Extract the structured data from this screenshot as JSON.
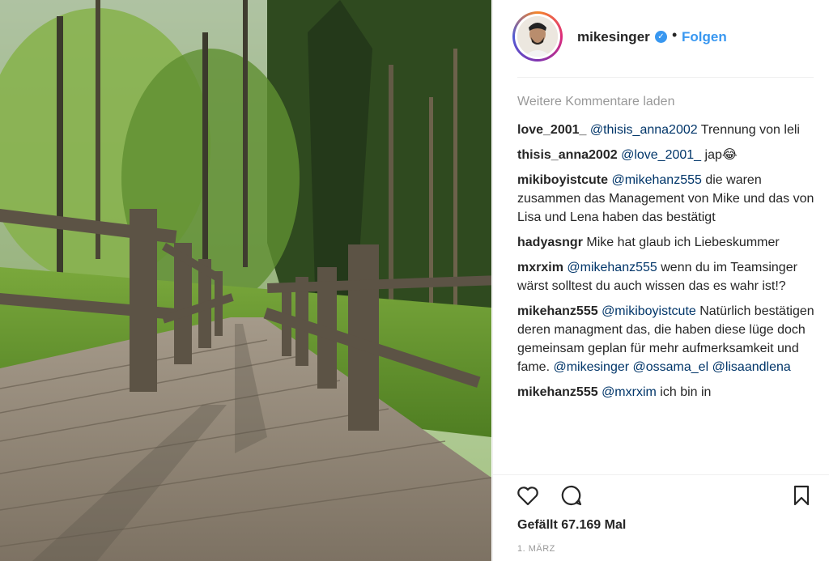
{
  "post": {
    "username": "mikesinger",
    "follow_label": "Folgen",
    "load_more_label": "Weitere Kommentare laden",
    "likes_text": "Gefällt 67.169 Mal",
    "date_text": "1. MÄRZ"
  },
  "comments": [
    {
      "user": "love_2001_",
      "mention": "@thisis_anna2002",
      "text": " Trennung von leli"
    },
    {
      "user": "thisis_anna2002",
      "mention": "@love_2001_",
      "text": " jap😂"
    },
    {
      "user": "mikiboyistcute",
      "mention": "@mikehanz555",
      "text": " die waren zusammen das Management von Mike und das von Lisa und Lena haben das bestätigt"
    },
    {
      "user": "hadyasngr",
      "mention": "",
      "text": " Mike hat glaub ich Liebeskummer"
    },
    {
      "user": "mxrxim",
      "mention": "@mikehanz555",
      "text": " wenn du im Teamsinger wärst solltest du auch wissen das es wahr ist!?"
    },
    {
      "user": "mikehanz555",
      "mention": "@mikiboyistcute",
      "text": " Natürlich bestätigen deren managment das, die haben diese lüge doch gemeinsam geplan für mehr aufmerksamkeit und fame. ",
      "mentions_after": "@mikesinger @ossama_el @lisaandlena"
    },
    {
      "user": "mikehanz555",
      "mention": "@mxrxim",
      "text": " ich bin in"
    }
  ],
  "icons": {
    "like": "heart-icon",
    "comment": "comment-icon",
    "save": "bookmark-icon",
    "verified": "verified-badge-icon"
  },
  "colors": {
    "link": "#3897f0",
    "mention": "#003569",
    "muted": "#999999"
  }
}
